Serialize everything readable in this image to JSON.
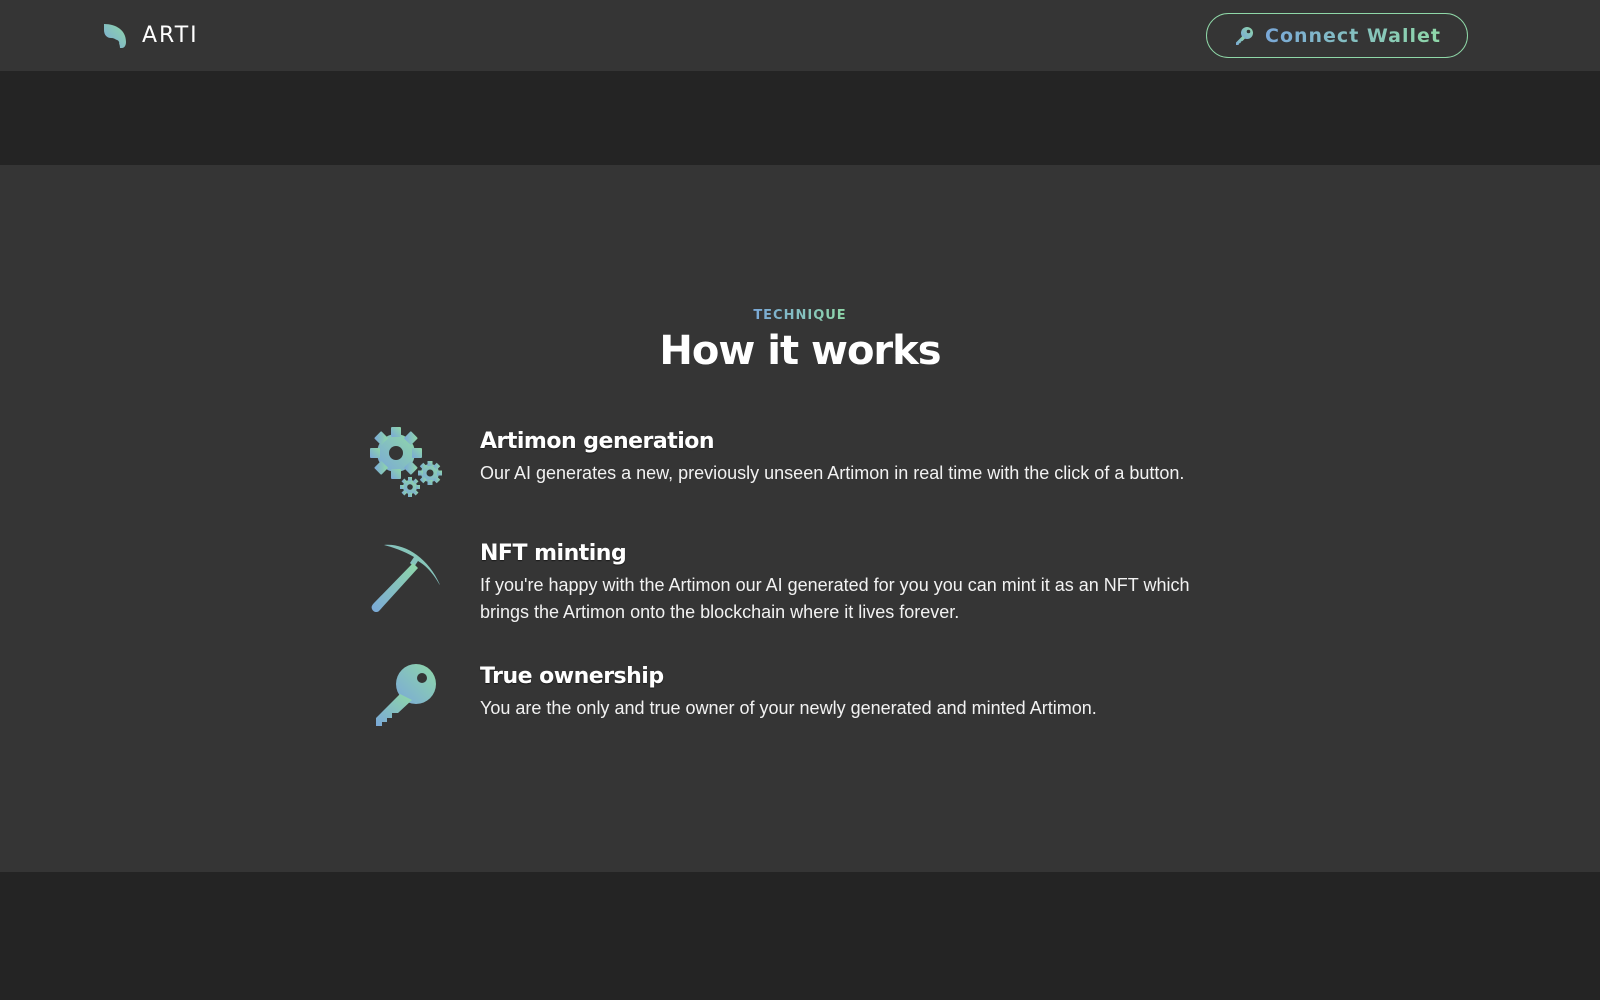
{
  "navbar": {
    "brand_name": "ARTI",
    "logo_icon": "leaf-logo-icon",
    "connect_label": "Connect Wallet",
    "connect_icon": "key-icon"
  },
  "section": {
    "eyebrow": "TECHNIQUE",
    "title": "How it works",
    "features": [
      {
        "icon": "gears-icon",
        "title": "Artimon generation",
        "description": "Our AI generates a new, previously unseen Artimon in real time with the click of a button."
      },
      {
        "icon": "pickaxe-icon",
        "title": "NFT minting",
        "description": "If you're happy with the Artimon our AI generated for you you can mint it as an NFT which brings the Artimon onto the blockchain where it lives forever."
      },
      {
        "icon": "key-icon",
        "title": "True ownership",
        "description": "You are the only and true owner of your newly generated and minted Artimon."
      }
    ]
  },
  "colors": {
    "gradient_start": "#7aa8d8",
    "gradient_end": "#8fd8a8",
    "surface": "#353535",
    "background": "#242424"
  }
}
